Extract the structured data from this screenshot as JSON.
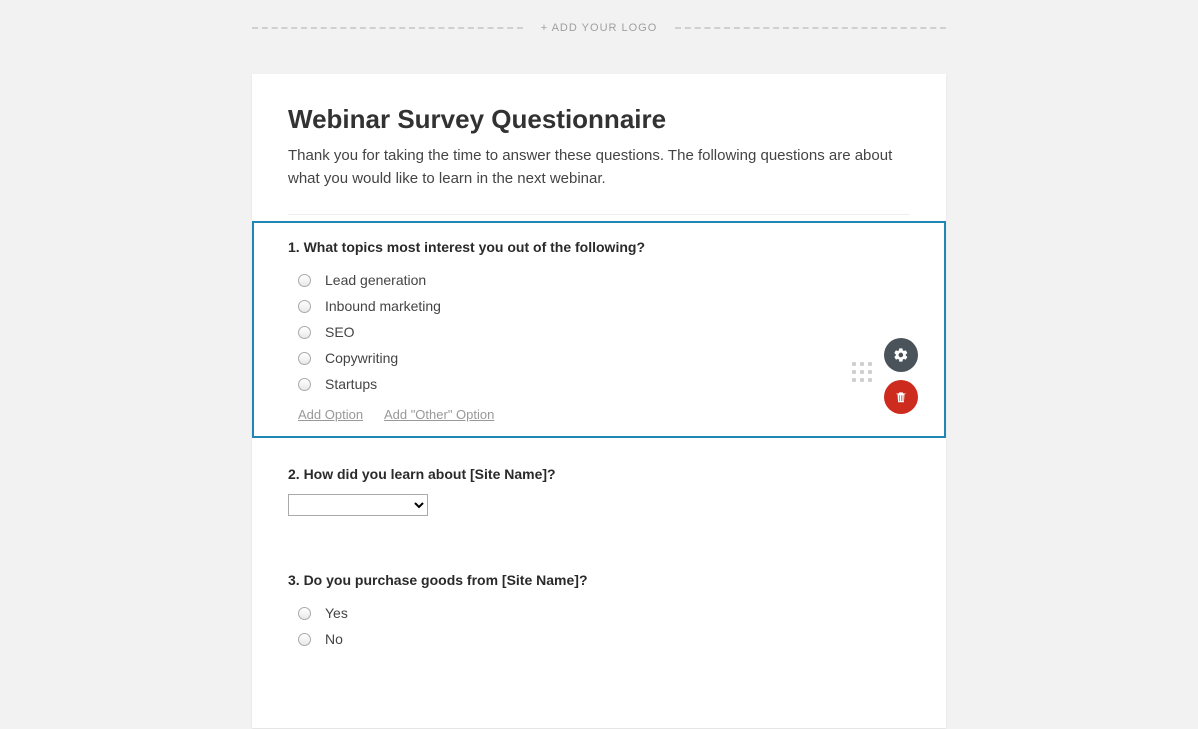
{
  "logoBar": {
    "addLogo": "+ ADD YOUR LOGO"
  },
  "header": {
    "title": "Webinar Survey Questionnaire",
    "description": "Thank you for taking the time to answer these questions. The following questions are about what you would like to learn in the next webinar."
  },
  "q1": {
    "title": "1. What topics most interest you out of the following?",
    "options": [
      "Lead generation",
      "Inbound marketing",
      "SEO",
      "Copywriting",
      "Startups"
    ],
    "addOption": "Add Option",
    "addOther": "Add \"Other\" Option"
  },
  "q2": {
    "title": "2. How did you learn about [Site Name]?"
  },
  "q3": {
    "title": "3. Do you purchase goods from [Site Name]?",
    "options": [
      "Yes",
      "No"
    ]
  },
  "actions": {
    "settings": "settings",
    "delete": "delete"
  }
}
